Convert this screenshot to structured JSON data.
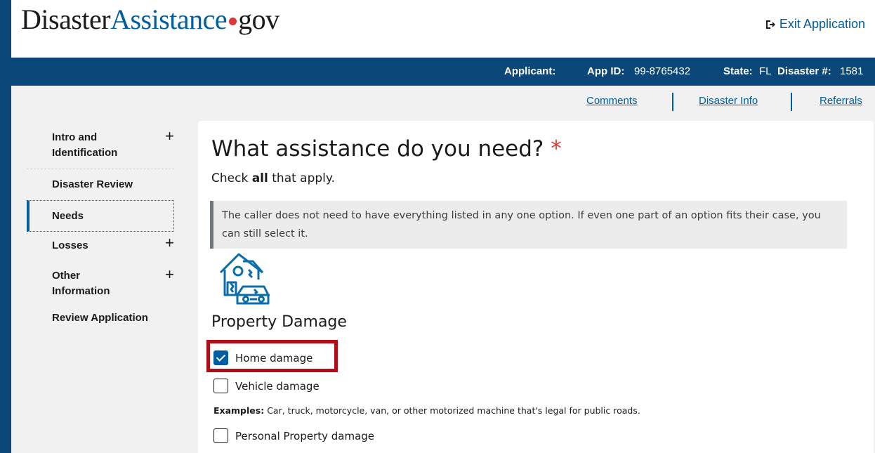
{
  "header": {
    "logo_part1": "Disaster",
    "logo_part2": "Assistance",
    "logo_part3": "gov",
    "exit_label": "Exit Application"
  },
  "app_bar": {
    "applicant_label": "Applicant:",
    "app_id_label": "App ID:",
    "app_id_value": "99-8765432",
    "state_label": "State:",
    "state_value": "FL",
    "disaster_label": "Disaster #:",
    "disaster_value": "1581"
  },
  "sub_links": {
    "comments": "Comments",
    "disaster_info": "Disaster Info",
    "referrals": "Referrals"
  },
  "sidebar": {
    "items": [
      {
        "label_line1": "Intro and",
        "label_line2": "Identification",
        "expandable": true
      },
      {
        "label": "Disaster Review",
        "expandable": false
      },
      {
        "label": "Needs",
        "expandable": false,
        "current": true
      },
      {
        "label": "Losses",
        "expandable": true
      },
      {
        "label_line1": "Other",
        "label_line2": "Information",
        "expandable": true
      },
      {
        "label": "Review Application",
        "expandable": false
      }
    ],
    "plus_glyph": "+"
  },
  "main": {
    "question": "What assistance do you need?",
    "required_mark": "*",
    "instruction_pre": "Check ",
    "instruction_bold": "all",
    "instruction_post": " that apply.",
    "note": "The caller does not need to have everything listed in any one option. If even one part of an option fits their case, you can still select it.",
    "section_icon": "house-car-damage-icon",
    "section_title": "Property Damage",
    "options": [
      {
        "label": "Home damage",
        "checked": true
      },
      {
        "label": "Vehicle damage",
        "checked": false
      },
      {
        "label": "Personal Property damage",
        "checked": false
      }
    ],
    "examples_label": "Examples:",
    "examples_text": " Car, truck, motorcycle, van, or other motorized machine that's legal for public roads."
  },
  "colors": {
    "brand_blue": "#0b4778",
    "link_blue": "#005ea2",
    "required_red": "#d83933",
    "highlight_red": "#b20d17"
  }
}
